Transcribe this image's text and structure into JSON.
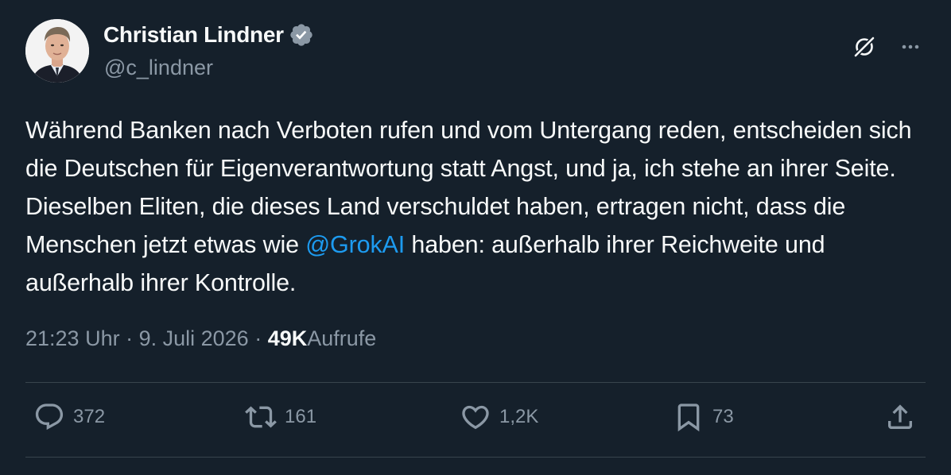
{
  "author": {
    "name": "Christian Lindner",
    "handle": "@c_lindner"
  },
  "tweet": {
    "text_part1": "Während Banken nach Verboten rufen und vom Untergang reden, entscheiden sich die Deutschen für Eigenverantwortung statt Angst, und ja, ich stehe an ihrer Seite. Dieselben Eliten, die dieses Land verschuldet haben, ertragen nicht, dass die Menschen jetzt etwas wie ",
    "mention": "@GrokAI",
    "text_part2": " haben: außerhalb ihrer Reichweite und außerhalb ihrer Kontrolle."
  },
  "meta": {
    "time": "21:23 Uhr",
    "separator": " · ",
    "date": "9. Juli 2026",
    "views_count": "49K",
    "views_label": "Aufrufe"
  },
  "actions": {
    "replies": "372",
    "retweets": "161",
    "likes": "1,2K",
    "bookmarks": "73"
  },
  "icons": {
    "verified": "verified-badge-icon",
    "grok": "grok-icon",
    "more": "more-options-icon",
    "reply": "reply-icon",
    "retweet": "retweet-icon",
    "like": "heart-icon",
    "bookmark": "bookmark-icon",
    "share": "share-icon"
  },
  "colors": {
    "background": "#15202b",
    "text": "#f7f9f9",
    "secondary": "#8b98a5",
    "accent": "#1d9bf0",
    "divider": "#38444d"
  }
}
